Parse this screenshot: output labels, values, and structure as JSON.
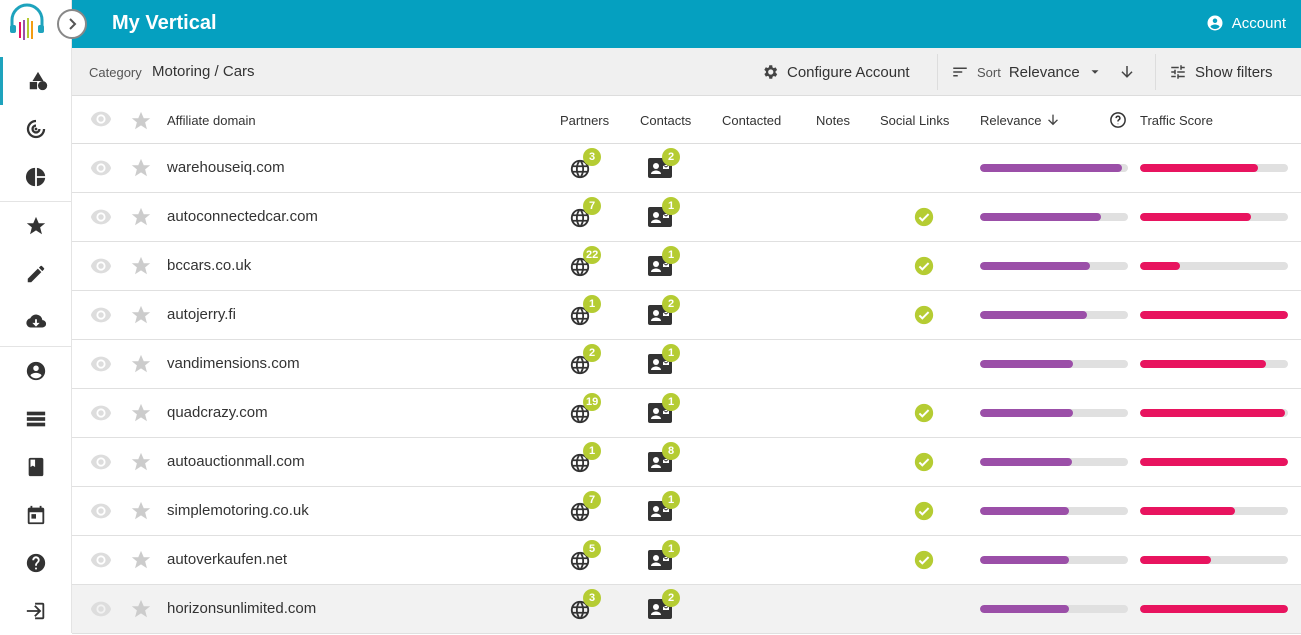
{
  "app": {
    "title": "My Vertical",
    "account_label": "Account",
    "brand_color": "#05a0c0"
  },
  "toolbar": {
    "category_label": "Category",
    "category_value": "Motoring / Cars",
    "configure_label": "Configure Account",
    "sort_label": "Sort",
    "sort_value": "Relevance",
    "filters_label": "Show filters"
  },
  "sidebar": {
    "items": [
      {
        "icon": "shapes-icon"
      },
      {
        "icon": "radar-icon"
      },
      {
        "icon": "pie-chart-icon"
      },
      {
        "icon": "star-icon"
      },
      {
        "icon": "pencil-icon"
      },
      {
        "icon": "cloud-download-icon"
      },
      {
        "icon": "account-circle-icon"
      },
      {
        "icon": "list-icon"
      },
      {
        "icon": "book-icon"
      },
      {
        "icon": "calendar-icon"
      },
      {
        "icon": "help-icon"
      },
      {
        "icon": "logout-icon"
      }
    ]
  },
  "table": {
    "columns": {
      "domain": "Affiliate domain",
      "partners": "Partners",
      "contacts": "Contacts",
      "contacted": "Contacted",
      "notes": "Notes",
      "social": "Social Links",
      "relevance": "Relevance",
      "traffic": "Traffic Score"
    },
    "rows": [
      {
        "domain": "warehouseiq.com",
        "partners": "3",
        "contacts": "2",
        "social": false,
        "relevance": 0.96,
        "traffic": 0.8
      },
      {
        "domain": "autoconnectedcar.com",
        "partners": "7",
        "contacts": "1",
        "social": true,
        "relevance": 0.82,
        "traffic": 0.75
      },
      {
        "domain": "bccars.co.uk",
        "partners": "22",
        "contacts": "1",
        "social": true,
        "relevance": 0.74,
        "traffic": 0.27
      },
      {
        "domain": "autojerry.fi",
        "partners": "1",
        "contacts": "2",
        "social": true,
        "relevance": 0.72,
        "traffic": 1.0
      },
      {
        "domain": "vandimensions.com",
        "partners": "2",
        "contacts": "1",
        "social": false,
        "relevance": 0.63,
        "traffic": 0.85
      },
      {
        "domain": "quadcrazy.com",
        "partners": "19",
        "contacts": "1",
        "social": true,
        "relevance": 0.63,
        "traffic": 0.98
      },
      {
        "domain": "autoauctionmall.com",
        "partners": "1",
        "contacts": "8",
        "social": true,
        "relevance": 0.62,
        "traffic": 1.0
      },
      {
        "domain": "simplemotoring.co.uk",
        "partners": "7",
        "contacts": "1",
        "social": true,
        "relevance": 0.6,
        "traffic": 0.64
      },
      {
        "domain": "autoverkaufen.net",
        "partners": "5",
        "contacts": "1",
        "social": true,
        "relevance": 0.6,
        "traffic": 0.48
      },
      {
        "domain": "horizonsunlimited.com",
        "partners": "3",
        "contacts": "2",
        "social": false,
        "relevance": 0.6,
        "traffic": 1.0
      }
    ]
  }
}
